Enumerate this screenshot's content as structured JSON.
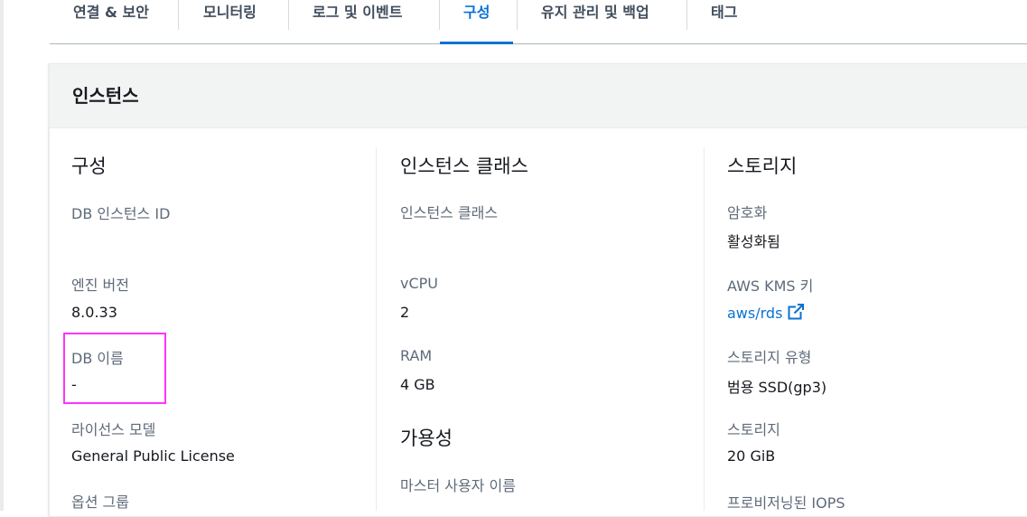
{
  "tabs": [
    {
      "label": "연결 & 보안"
    },
    {
      "label": "모니터링"
    },
    {
      "label": "로그 및 이벤트"
    },
    {
      "label": "구성"
    },
    {
      "label": "유지 관리 및 백업"
    },
    {
      "label": "태그"
    }
  ],
  "active_tab": "구성",
  "panel": {
    "title": "인스턴스"
  },
  "config": {
    "title": "구성",
    "db_instance_id_label": "DB 인스턴스 ID",
    "engine_version_label": "엔진 버전",
    "engine_version_value": "8.0.33",
    "db_name_label": "DB 이름",
    "db_name_value": "-",
    "license_model_label": "라이선스 모델",
    "license_model_value": "General Public License",
    "option_group_label": "옵션 그룹"
  },
  "instance_class": {
    "title": "인스턴스 클래스",
    "class_label": "인스턴스 클래스",
    "vcpu_label": "vCPU",
    "vcpu_value": "2",
    "ram_label": "RAM",
    "ram_value": "4 GB"
  },
  "availability": {
    "title": "가용성",
    "master_user_label": "마스터 사용자 이름"
  },
  "storage": {
    "title": "스토리지",
    "encryption_label": "암호화",
    "encryption_value": "활성화됨",
    "kms_key_label": "AWS KMS 키",
    "kms_key_value": "aws/rds",
    "storage_type_label": "스토리지 유형",
    "storage_type_value": "범용 SSD(gp3)",
    "storage_label": "스토리지",
    "storage_value": "20 GiB",
    "iops_label": "프로비저닝된 IOPS"
  },
  "colors": {
    "accent": "#0972d3",
    "highlight": "#ff33ff"
  },
  "icons": {
    "external_link": "external-link-icon"
  }
}
